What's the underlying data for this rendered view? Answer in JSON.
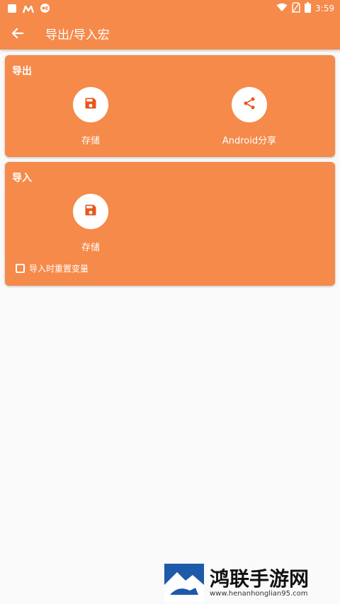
{
  "status_bar": {
    "time": "3:59"
  },
  "app_bar": {
    "title": "导出/导入宏"
  },
  "export_card": {
    "title": "导出",
    "actions": [
      {
        "label": "存储",
        "icon": "save-icon"
      },
      {
        "label": "Android分享",
        "icon": "share-icon"
      }
    ]
  },
  "import_card": {
    "title": "导入",
    "actions": [
      {
        "label": "存储",
        "icon": "save-icon"
      }
    ],
    "reset_checkbox_label": "导入时重置变量"
  },
  "watermark": {
    "title": "鸿联手游网",
    "url": "www.henanhonglian95.com"
  },
  "colors": {
    "accent": "#f58a4a",
    "icon": "#e8561a",
    "background": "#fafafa"
  }
}
